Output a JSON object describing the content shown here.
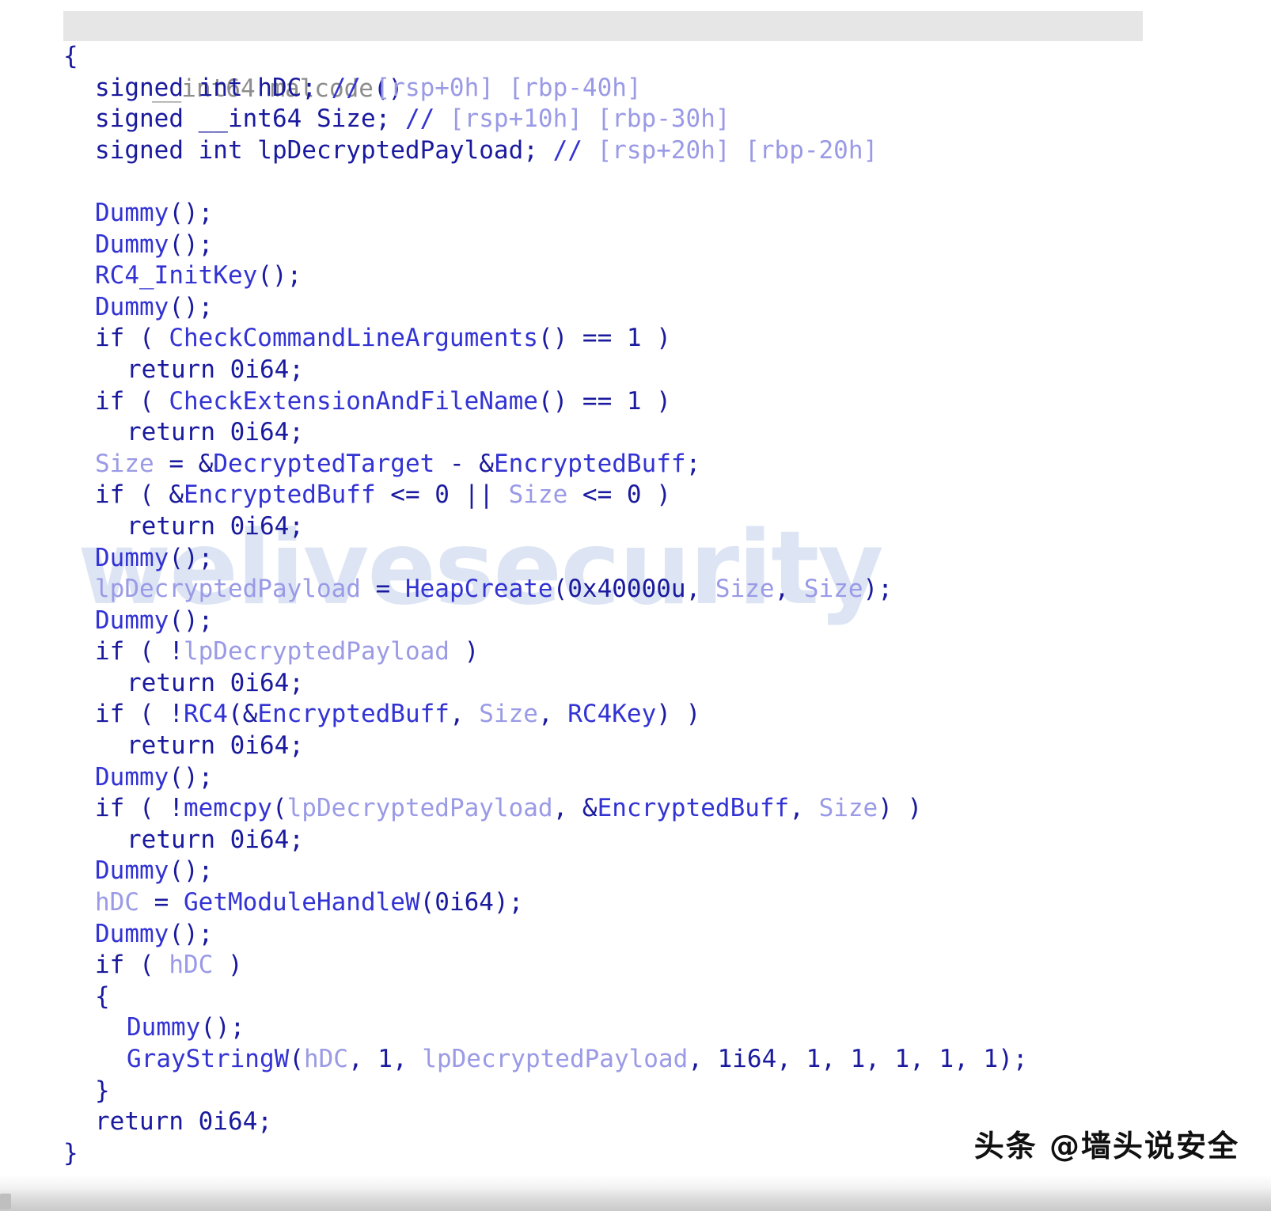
{
  "view": {
    "kind": "hex-rays-pseudocode",
    "background": "#ffffff",
    "signature_highlight_color": "#e6e6e6",
    "colors": {
      "plain": "#1a1a9e",
      "function": "#3333d4",
      "local_variable": "#9a9ae6",
      "comment": "#9a9ae6",
      "signature_type": "#8d8d8d",
      "watermark": "#dde5f4"
    }
  },
  "watermarks": {
    "brand": "welivesecurity",
    "channel": "头条 @墙头说安全"
  },
  "code": {
    "signature": {
      "type": "__int64",
      "name": "malcode",
      "params": "()"
    },
    "lines": [
      {
        "indent": 0,
        "tokens": [
          {
            "t": "{",
            "c": "plain"
          }
        ]
      },
      {
        "indent": 1,
        "tokens": [
          {
            "t": "signed int hDC; ",
            "c": "plain"
          },
          {
            "t": "//",
            "c": "cslash"
          },
          {
            "t": " [rsp+0h] [rbp-40h]",
            "c": "comment"
          }
        ]
      },
      {
        "indent": 1,
        "tokens": [
          {
            "t": "signed __int64 Size; ",
            "c": "plain"
          },
          {
            "t": "//",
            "c": "cslash"
          },
          {
            "t": " [rsp+10h] [rbp-30h]",
            "c": "comment"
          }
        ]
      },
      {
        "indent": 1,
        "tokens": [
          {
            "t": "signed int lpDecryptedPayload; ",
            "c": "plain"
          },
          {
            "t": "//",
            "c": "cslash"
          },
          {
            "t": " [rsp+20h] [rbp-20h]",
            "c": "comment"
          }
        ]
      },
      {
        "indent": 0,
        "tokens": []
      },
      {
        "indent": 1,
        "tokens": [
          {
            "t": "Dummy",
            "c": "func"
          },
          {
            "t": "();",
            "c": "plain"
          }
        ]
      },
      {
        "indent": 1,
        "tokens": [
          {
            "t": "Dummy",
            "c": "func"
          },
          {
            "t": "();",
            "c": "plain"
          }
        ]
      },
      {
        "indent": 1,
        "tokens": [
          {
            "t": "RC4_InitKey",
            "c": "func"
          },
          {
            "t": "();",
            "c": "plain"
          }
        ]
      },
      {
        "indent": 1,
        "tokens": [
          {
            "t": "Dummy",
            "c": "func"
          },
          {
            "t": "();",
            "c": "plain"
          }
        ]
      },
      {
        "indent": 1,
        "tokens": [
          {
            "t": "if ( ",
            "c": "plain"
          },
          {
            "t": "CheckCommandLineArguments",
            "c": "func"
          },
          {
            "t": "() == 1 )",
            "c": "plain"
          }
        ]
      },
      {
        "indent": 2,
        "tokens": [
          {
            "t": "return 0i64;",
            "c": "plain"
          }
        ]
      },
      {
        "indent": 1,
        "tokens": [
          {
            "t": "if ( ",
            "c": "plain"
          },
          {
            "t": "CheckExtensionAndFileName",
            "c": "func"
          },
          {
            "t": "() == 1 )",
            "c": "plain"
          }
        ]
      },
      {
        "indent": 2,
        "tokens": [
          {
            "t": "return 0i64;",
            "c": "plain"
          }
        ]
      },
      {
        "indent": 1,
        "tokens": [
          {
            "t": "Size",
            "c": "local"
          },
          {
            "t": " = &",
            "c": "plain"
          },
          {
            "t": "DecryptedTarget",
            "c": "func"
          },
          {
            "t": " - &",
            "c": "plain"
          },
          {
            "t": "EncryptedBuff",
            "c": "func"
          },
          {
            "t": ";",
            "c": "plain"
          }
        ]
      },
      {
        "indent": 1,
        "tokens": [
          {
            "t": "if ( &",
            "c": "plain"
          },
          {
            "t": "EncryptedBuff",
            "c": "func"
          },
          {
            "t": " <= 0 || ",
            "c": "plain"
          },
          {
            "t": "Size",
            "c": "local"
          },
          {
            "t": " <= 0 )",
            "c": "plain"
          }
        ]
      },
      {
        "indent": 2,
        "tokens": [
          {
            "t": "return 0i64;",
            "c": "plain"
          }
        ]
      },
      {
        "indent": 1,
        "tokens": [
          {
            "t": "Dummy",
            "c": "func"
          },
          {
            "t": "();",
            "c": "plain"
          }
        ]
      },
      {
        "indent": 1,
        "tokens": [
          {
            "t": "lpDecryptedPayload",
            "c": "local"
          },
          {
            "t": " = ",
            "c": "plain"
          },
          {
            "t": "HeapCreate",
            "c": "func"
          },
          {
            "t": "(0x40000u, ",
            "c": "plain"
          },
          {
            "t": "Size",
            "c": "local"
          },
          {
            "t": ", ",
            "c": "plain"
          },
          {
            "t": "Size",
            "c": "local"
          },
          {
            "t": ");",
            "c": "plain"
          }
        ]
      },
      {
        "indent": 1,
        "tokens": [
          {
            "t": "Dummy",
            "c": "func"
          },
          {
            "t": "();",
            "c": "plain"
          }
        ]
      },
      {
        "indent": 1,
        "tokens": [
          {
            "t": "if ( !",
            "c": "plain"
          },
          {
            "t": "lpDecryptedPayload",
            "c": "local"
          },
          {
            "t": " )",
            "c": "plain"
          }
        ]
      },
      {
        "indent": 2,
        "tokens": [
          {
            "t": "return 0i64;",
            "c": "plain"
          }
        ]
      },
      {
        "indent": 1,
        "tokens": [
          {
            "t": "if ( !",
            "c": "plain"
          },
          {
            "t": "RC4",
            "c": "func"
          },
          {
            "t": "(&",
            "c": "plain"
          },
          {
            "t": "EncryptedBuff",
            "c": "func"
          },
          {
            "t": ", ",
            "c": "plain"
          },
          {
            "t": "Size",
            "c": "local"
          },
          {
            "t": ", ",
            "c": "plain"
          },
          {
            "t": "RC4Key",
            "c": "func"
          },
          {
            "t": ") )",
            "c": "plain"
          }
        ]
      },
      {
        "indent": 2,
        "tokens": [
          {
            "t": "return 0i64;",
            "c": "plain"
          }
        ]
      },
      {
        "indent": 1,
        "tokens": [
          {
            "t": "Dummy",
            "c": "func"
          },
          {
            "t": "();",
            "c": "plain"
          }
        ]
      },
      {
        "indent": 1,
        "tokens": [
          {
            "t": "if ( !",
            "c": "plain"
          },
          {
            "t": "memcpy",
            "c": "func"
          },
          {
            "t": "(",
            "c": "plain"
          },
          {
            "t": "lpDecryptedPayload",
            "c": "local"
          },
          {
            "t": ", &",
            "c": "plain"
          },
          {
            "t": "EncryptedBuff",
            "c": "func"
          },
          {
            "t": ", ",
            "c": "plain"
          },
          {
            "t": "Size",
            "c": "local"
          },
          {
            "t": ") )",
            "c": "plain"
          }
        ]
      },
      {
        "indent": 2,
        "tokens": [
          {
            "t": "return 0i64;",
            "c": "plain"
          }
        ]
      },
      {
        "indent": 1,
        "tokens": [
          {
            "t": "Dummy",
            "c": "func"
          },
          {
            "t": "();",
            "c": "plain"
          }
        ]
      },
      {
        "indent": 1,
        "tokens": [
          {
            "t": "hDC",
            "c": "local"
          },
          {
            "t": " = ",
            "c": "plain"
          },
          {
            "t": "GetModuleHandleW",
            "c": "func"
          },
          {
            "t": "(0i64);",
            "c": "plain"
          }
        ]
      },
      {
        "indent": 1,
        "tokens": [
          {
            "t": "Dummy",
            "c": "func"
          },
          {
            "t": "();",
            "c": "plain"
          }
        ]
      },
      {
        "indent": 1,
        "tokens": [
          {
            "t": "if ( ",
            "c": "plain"
          },
          {
            "t": "hDC",
            "c": "local"
          },
          {
            "t": " )",
            "c": "plain"
          }
        ]
      },
      {
        "indent": 1,
        "tokens": [
          {
            "t": "{",
            "c": "plain"
          }
        ]
      },
      {
        "indent": 2,
        "tokens": [
          {
            "t": "Dummy",
            "c": "func"
          },
          {
            "t": "();",
            "c": "plain"
          }
        ]
      },
      {
        "indent": 2,
        "tokens": [
          {
            "t": "GrayStringW",
            "c": "func"
          },
          {
            "t": "(",
            "c": "plain"
          },
          {
            "t": "hDC",
            "c": "local"
          },
          {
            "t": ", 1, ",
            "c": "plain"
          },
          {
            "t": "lpDecryptedPayload",
            "c": "local"
          },
          {
            "t": ", 1i64, 1, 1, 1, 1, 1);",
            "c": "plain"
          }
        ]
      },
      {
        "indent": 1,
        "tokens": [
          {
            "t": "}",
            "c": "plain"
          }
        ]
      },
      {
        "indent": 1,
        "tokens": [
          {
            "t": "return 0i64;",
            "c": "plain"
          }
        ]
      },
      {
        "indent": 0,
        "tokens": [
          {
            "t": "}",
            "c": "plain"
          }
        ]
      }
    ]
  }
}
